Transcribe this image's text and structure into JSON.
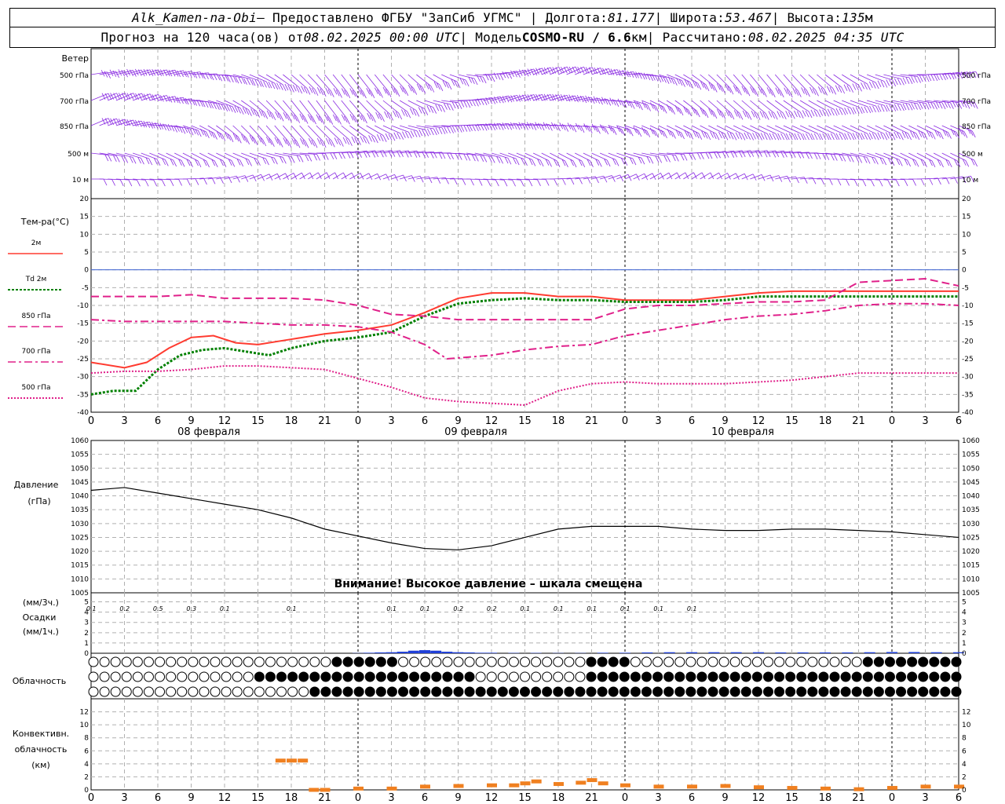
{
  "header": {
    "station": "Alk_Kamen-na-Obi",
    "provider": " – Предоставлено ФГБУ \"ЗапСиб УГМС\" | Долгота: ",
    "longitude": "81.177",
    "lat_label": " | Широта: ",
    "latitude": "53.467",
    "alt_label": " | Высота: ",
    "altitude": "135",
    "alt_unit": "м",
    "forecast_label": "Прогноз на 120 часа(ов) от ",
    "issue_time": "08.02.2025 00:00 UTC",
    "model_label": " | Модель ",
    "model": "COSMO-RU / 6.6",
    "model_unit": "км",
    "calc_label": " | Рассчитано: ",
    "calc_time": "08.02.2025 04:35 UTC"
  },
  "colors": {
    "wind": "#8a2be2",
    "t2m": "#ff3b30",
    "td2m": "#008000",
    "t850": "#e0208a",
    "t700": "#e0208a",
    "t500": "#e0208a",
    "zero_line": "#3a5fd0",
    "pressure": "#000000",
    "precip": "#1f3fd8",
    "convective": "#f08020",
    "grid": "#b0b0b0",
    "day_line": "#000000"
  },
  "wind_panel": {
    "title": "Ветер",
    "levels": [
      "500 гПа",
      "700 гПа",
      "850 гПа",
      "500 м",
      "10  м"
    ]
  },
  "temp_panel": {
    "title": "Тем-ра(°С)",
    "legend": [
      "2м",
      "Td 2м",
      "850 гПа",
      "700 гПа",
      "500 гПа"
    ],
    "yticks": [
      "20",
      "15",
      "10",
      "5",
      "0",
      "-5",
      "-10",
      "-15",
      "-20",
      "-25",
      "-30",
      "-35",
      "-40"
    ]
  },
  "pressure_panel": {
    "title": "Давление",
    "unit": "(гПа)",
    "warning": "Внимание! Высокое давление – шкала смещена",
    "yticks": [
      "1060",
      "1055",
      "1050",
      "1045",
      "1040",
      "1035",
      "1030",
      "1025",
      "1020",
      "1015",
      "1010",
      "1005"
    ]
  },
  "precip_panel": {
    "unit3h": "(мм/3ч.)",
    "title": "Осадки",
    "unit1h": "(мм/1ч.)",
    "yticks": [
      "5",
      "4",
      "3",
      "2",
      "1",
      "0"
    ],
    "labels": [
      {
        "h": 0,
        "t": "0.1"
      },
      {
        "h": 3,
        "t": "0.2"
      },
      {
        "h": 6,
        "t": "0.5"
      },
      {
        "h": 9,
        "t": "0.3"
      },
      {
        "h": 12,
        "t": "0.1"
      },
      {
        "h": 18,
        "t": "0.1"
      },
      {
        "h": 27,
        "t": "0.1"
      },
      {
        "h": 30,
        "t": "0.1"
      },
      {
        "h": 33,
        "t": "0.2"
      },
      {
        "h": 36,
        "t": "0.2"
      },
      {
        "h": 39,
        "t": "0.1"
      },
      {
        "h": 42,
        "t": "0.1"
      },
      {
        "h": 45,
        "t": "0.1"
      },
      {
        "h": 48,
        "t": "0.1"
      },
      {
        "h": 51,
        "t": "0.1"
      },
      {
        "h": 54,
        "t": "0.1"
      }
    ]
  },
  "cloud_panel": {
    "title": "Облачность"
  },
  "conv_panel": {
    "title1": "Конвективн.",
    "title2": "облачность",
    "unit": "(км)",
    "yticks": [
      "12",
      "10",
      "8",
      "6",
      "4",
      "2",
      "0"
    ]
  },
  "x_axis": {
    "hour_labels": [
      "0",
      "3",
      "6",
      "9",
      "12",
      "15",
      "18",
      "21",
      "0",
      "3",
      "6",
      "9",
      "12",
      "15",
      "18",
      "21",
      "0",
      "3",
      "6",
      "9",
      "12",
      "15",
      "18",
      "21",
      "0",
      "3",
      "6"
    ],
    "dates": [
      "08 февраля",
      "09 февраля",
      "10 февраля"
    ]
  },
  "chart_data": {
    "type": "line",
    "x_hours_from_start": "0..78 (08.02.2025 00 UTC → 11.02.2025 06 UTC)",
    "temperature": {
      "ylim": [
        -40,
        20
      ],
      "series": [
        {
          "name": "2м",
          "x": [
            0,
            3,
            5,
            7,
            9,
            11,
            13,
            15,
            18,
            21,
            24,
            27,
            30,
            33,
            36,
            39,
            42,
            45,
            48,
            51,
            54,
            57,
            60,
            63,
            66,
            69,
            72,
            75,
            78
          ],
          "values": [
            -26,
            -27.5,
            -26,
            -22,
            -19,
            -18.5,
            -20.5,
            -21,
            -19.5,
            -18,
            -17,
            -15.5,
            -12,
            -8,
            -6.5,
            -6.5,
            -7.5,
            -7.5,
            -8.5,
            -8.5,
            -8.5,
            -7.5,
            -6.5,
            -6,
            -6,
            -6,
            -6,
            -6,
            -6
          ]
        },
        {
          "name": "Td 2м",
          "x": [
            0,
            2,
            4,
            6,
            8,
            10,
            12,
            14,
            16,
            18,
            21,
            24,
            27,
            30,
            33,
            36,
            39,
            42,
            45,
            48,
            51,
            54,
            57,
            60,
            63,
            66,
            69,
            72,
            75,
            78
          ],
          "values": [
            -35,
            -34,
            -34,
            -28,
            -24,
            -22.5,
            -22,
            -23,
            -24,
            -22,
            -20,
            -19,
            -17.5,
            -13,
            -9.5,
            -8.5,
            -8,
            -8.5,
            -8.5,
            -9,
            -9,
            -9,
            -8.5,
            -7.5,
            -7.5,
            -7.5,
            -7.5,
            -7.5,
            -7.5,
            -7.5
          ]
        },
        {
          "name": "850 гПа",
          "x": [
            0,
            3,
            6,
            9,
            12,
            15,
            18,
            21,
            24,
            27,
            30,
            33,
            36,
            39,
            42,
            45,
            48,
            51,
            54,
            57,
            60,
            63,
            66,
            69,
            72,
            75,
            78
          ],
          "values": [
            -7.5,
            -7.5,
            -7.5,
            -7,
            -8,
            -8,
            -8,
            -8.5,
            -10,
            -12.5,
            -13,
            -14,
            -14,
            -14,
            -14,
            -14,
            -11,
            -10,
            -10,
            -9.5,
            -9,
            -9,
            -8.5,
            -3.5,
            -3,
            -2.5,
            -4.5
          ]
        },
        {
          "name": "700 гПа",
          "x": [
            0,
            3,
            6,
            9,
            12,
            15,
            18,
            21,
            24,
            27,
            30,
            32,
            34,
            36,
            39,
            42,
            45,
            48,
            51,
            54,
            57,
            60,
            63,
            66,
            69,
            72,
            75,
            78
          ],
          "values": [
            -14,
            -14.5,
            -14.5,
            -14.5,
            -14.5,
            -15,
            -15.5,
            -15.5,
            -16,
            -17.5,
            -21,
            -25,
            -24.5,
            -24,
            -22.5,
            -21.5,
            -21,
            -18.5,
            -17,
            -15.5,
            -14,
            -13,
            -12.5,
            -11.5,
            -10,
            -9.5,
            -9.5,
            -10
          ]
        },
        {
          "name": "500 гПа",
          "x": [
            0,
            3,
            6,
            9,
            12,
            15,
            18,
            21,
            24,
            27,
            30,
            33,
            36,
            39,
            42,
            45,
            48,
            51,
            54,
            57,
            60,
            63,
            66,
            69,
            72,
            75,
            78
          ],
          "values": [
            -29,
            -28.5,
            -28.5,
            -28,
            -27,
            -27,
            -27.5,
            -28,
            -30.5,
            -33,
            -36,
            -37,
            -37.5,
            -38,
            -34,
            -32,
            -31.5,
            -32,
            -32,
            -32,
            -31.5,
            -31,
            -30,
            -29,
            -29,
            -29,
            -29
          ]
        }
      ]
    },
    "pressure": {
      "ylim": [
        1005,
        1060
      ],
      "x": [
        0,
        3,
        6,
        9,
        12,
        15,
        18,
        21,
        24,
        27,
        30,
        33,
        36,
        39,
        42,
        45,
        48,
        51,
        54,
        57,
        60,
        63,
        66,
        69,
        72,
        75,
        78
      ],
      "values": [
        1042,
        1043,
        1041,
        1039,
        1037,
        1035,
        1032,
        1028,
        1025.5,
        1023,
        1021,
        1020.5,
        1022,
        1025,
        1028,
        1029,
        1029,
        1029,
        1028,
        1027.5,
        1027.5,
        1028,
        1028,
        1027.5,
        1027,
        1026,
        1025
      ]
    },
    "precipitation_mm_1h": {
      "x": [
        24,
        25,
        26,
        27,
        28,
        29,
        30,
        31,
        32,
        33,
        34,
        35,
        36,
        38,
        40,
        42,
        44,
        46,
        48,
        50,
        52,
        54,
        56,
        58,
        60,
        62,
        64,
        66,
        68,
        70,
        72,
        74,
        76,
        78
      ],
      "values": [
        0.02,
        0.05,
        0.08,
        0.1,
        0.15,
        0.25,
        0.3,
        0.25,
        0.15,
        0.1,
        0.08,
        0.05,
        0.05,
        0.03,
        0.03,
        0.02,
        0.02,
        0.05,
        0.05,
        0.08,
        0.1,
        0.1,
        0.1,
        0.1,
        0.1,
        0.08,
        0.08,
        0.08,
        0.08,
        0.1,
        0.12,
        0.12,
        0.1,
        0.1
      ]
    },
    "convective_cloud_km": {
      "x": [
        17,
        18,
        19,
        20,
        21,
        24,
        27,
        30,
        33,
        36,
        38,
        39,
        40,
        42,
        44,
        45,
        46,
        48,
        51,
        54,
        57,
        60,
        63,
        66,
        69,
        72,
        75,
        78
      ],
      "tops": [
        4.8,
        4.8,
        4.8,
        0.3,
        0.3,
        0.5,
        0.5,
        0.8,
        0.9,
        1,
        1,
        1.3,
        1.6,
        1.2,
        1.4,
        1.8,
        1.3,
        1,
        0.8,
        0.8,
        0.9,
        0.7,
        0.6,
        0.5,
        0.4,
        0.6,
        0.8,
        0.8
      ]
    },
    "cloudiness_levels": [
      "low",
      "middle",
      "high"
    ]
  }
}
